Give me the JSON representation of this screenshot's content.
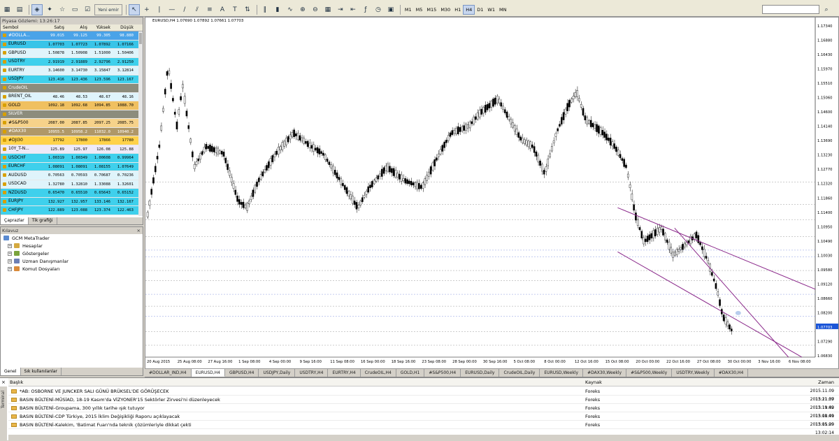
{
  "toolbar": {
    "new_order": "Yeni emir",
    "timeframes": [
      "M1",
      "M5",
      "M15",
      "M30",
      "H1",
      "H4",
      "D1",
      "W1",
      "MN"
    ],
    "active_timeframe": "H4"
  },
  "market_watch": {
    "title": "Piyasa Gözlemi: 13:26:17",
    "headers": [
      "Sembol",
      "Satış",
      "Alış",
      "Yüksek",
      "Düşük"
    ],
    "rows": [
      {
        "sym": "#DOLLA...",
        "bid": "99.015",
        "ask": "99.125",
        "high": "99.305",
        "low": "98.880",
        "bg": "#4aa3e8"
      },
      {
        "sym": "EURUSD",
        "bid": "1.07703",
        "ask": "1.07723",
        "high": "1.07892",
        "low": "1.07166",
        "bg": "#38c4e8"
      },
      {
        "sym": "GBPUSD",
        "bid": "1.50878",
        "ask": "1.50908",
        "high": "1.51000",
        "low": "1.50406",
        "bg": "#dff4fb"
      },
      {
        "sym": "USDTRY",
        "bid": "2.91919",
        "ask": "2.91889",
        "high": "2.92796",
        "low": "2.91250",
        "bg": "#3fd0ec"
      },
      {
        "sym": "EURTRY",
        "bid": "3.14600",
        "ask": "3.14730",
        "high": "3.15847",
        "low": "3.12814",
        "bg": "#dff4fb"
      },
      {
        "sym": "USDJPY",
        "bid": "123.416",
        "ask": "123.436",
        "high": "123.596",
        "low": "123.167",
        "bg": "#3fd0ec"
      },
      {
        "sym": "CrudeOIL",
        "bid": "",
        "ask": "",
        "high": "",
        "low": "",
        "bg": "#8c8c7c"
      },
      {
        "sym": "BRENT_OIL",
        "bid": "48.46",
        "ask": "48.53",
        "high": "48.67",
        "low": "48.16",
        "bg": "#dff4fb"
      },
      {
        "sym": "GOLD",
        "bid": "1092.18",
        "ask": "1092.68",
        "high": "1094.85",
        "low": "1088.70",
        "bg": "#f0c060"
      },
      {
        "sym": "SILVER",
        "bid": "",
        "ask": "",
        "high": "",
        "low": "",
        "bg": "#8c8c7c"
      },
      {
        "sym": "#S&P500",
        "bid": "2087.00",
        "ask": "2087.85",
        "high": "2097.25",
        "low": "2085.75",
        "bg": "#f6d28a"
      },
      {
        "sym": "#DAX30",
        "bid": "10955.5",
        "ask": "10958.2",
        "high": "11032.0",
        "low": "10940.2",
        "bg": "#b09868"
      },
      {
        "sym": "#DJI30",
        "bid": "17792",
        "ask": "17800",
        "high": "17866",
        "low": "17780",
        "bg": "#ffd24a"
      },
      {
        "sym": "10Y_T-N...",
        "bid": "125.89",
        "ask": "125.97",
        "high": "126.08",
        "low": "125.88",
        "bg": "#eeeaf8"
      },
      {
        "sym": "USDCHF",
        "bid": "1.00319",
        "ask": "1.00349",
        "high": "1.00608",
        "low": "0.99964",
        "bg": "#3fd0ec"
      },
      {
        "sym": "EURCHF",
        "bid": "1.08091",
        "ask": "1.08091",
        "high": "1.08155",
        "low": "1.07649",
        "bg": "#3fd0ec"
      },
      {
        "sym": "AUDUSD",
        "bid": "0.70563",
        "ask": "0.70593",
        "high": "0.70687",
        "low": "0.70236",
        "bg": "#dff4fb"
      },
      {
        "sym": "USDCAD",
        "bid": "1.32780",
        "ask": "1.32810",
        "high": "1.33088",
        "low": "1.32601",
        "bg": "#dff4fb"
      },
      {
        "sym": "NZDUSD",
        "bid": "0.65470",
        "ask": "0.65510",
        "high": "0.65643",
        "low": "0.65152",
        "bg": "#3fd0ec"
      },
      {
        "sym": "EURJPY",
        "bid": "132.927",
        "ask": "132.957",
        "high": "133.146",
        "low": "132.167",
        "bg": "#3fd0ec"
      },
      {
        "sym": "CHFJPY",
        "bid": "122.889",
        "ask": "123.088",
        "high": "123.374",
        "low": "122.463",
        "bg": "#3fd0ec"
      }
    ],
    "tabs": [
      "Çaprazlar",
      "Tik grafiği"
    ]
  },
  "navigator": {
    "title": "Kılavuz",
    "root": "GCM MetaTrader",
    "items": [
      "Hesaplar",
      "Göstergeler",
      "Uzman Danışmanlar",
      "Komut Dosyaları"
    ],
    "tabs": [
      "Genel",
      "Sık kullanılanlar"
    ]
  },
  "chart": {
    "info": "EURUSD,H4  1.07690 1.07892 1.07661 1.07703",
    "price_labels": [
      "1.17340",
      "1.16880",
      "1.16430",
      "1.15970",
      "1.15510",
      "1.15060",
      "1.14600",
      "1.14140",
      "1.13690",
      "1.13230",
      "1.12770",
      "1.12320",
      "1.11860",
      "1.11400",
      "1.10950",
      "1.10490",
      "1.10030",
      "1.09580",
      "1.09120",
      "1.08660",
      "1.08200",
      "1.07703",
      "1.07290",
      "1.06830"
    ],
    "date_labels": [
      "20 Aug 2015",
      "25 Aug 08:00",
      "27 Aug 16:00",
      "1 Sep 08:00",
      "4 Sep 00:00",
      "9 Sep 16:00",
      "11 Sep 08:00",
      "16 Sep 00:00",
      "18 Sep 16:00",
      "23 Sep 08:00",
      "28 Sep 00:00",
      "30 Sep 16:00",
      "5 Oct 08:00",
      "8 Oct 00:00",
      "12 Oct 16:00",
      "15 Oct 08:00",
      "20 Oct 00:00",
      "22 Oct 16:00",
      "27 Oct 08:00",
      "30 Oct 00:00",
      "3 Nov 16:00",
      "6 Nov 08:00"
    ],
    "current_price": "1.07703",
    "colors": {
      "channel": "#8b2a8b",
      "hline_gray": "#9a9a9a",
      "hline_blue": "#8a9ae0",
      "price_tag": "#1a55d8"
    }
  },
  "chart_tabs": [
    "#DOLLAR_IND,H4",
    "EURUSD,H4",
    "GBPUSD,H4",
    "USDJPY,Daily",
    "USDTRY,H4",
    "EURTRY,H4",
    "CrudeOIL,H4",
    "GOLD,H1",
    "#S&P500,H4",
    "EURUSD,Daily",
    "CrudeOIL,Daily",
    "EURUSD,Weekly",
    "#DAX30,Weekly",
    "#S&P500,Weekly",
    "USDTRY,Weekly",
    "#DAX30,H4"
  ],
  "active_chart_tab": 1,
  "terminal": {
    "side_label": "Terminal",
    "headers": {
      "title": "Başlık",
      "source": "Kaynak",
      "time": "Zaman"
    },
    "rows": [
      {
        "title": "*AB: OSBORNE VE JUNCKER SALI GÜNÜ BRÜKSEL'DE GÖRÜŞECEK",
        "source": "Foreks",
        "time": "2015.11.09 13:21:37"
      },
      {
        "title": "BASIN BÜLTENİ-MÜSİAD, 18-19 Kasım'da VİZYONER'15 Sektörler Zirvesi'ni düzenleyecek",
        "source": "Foreks",
        "time": "2015.11.09 13:19:42"
      },
      {
        "title": "BASIN BÜLTENİ-Groupama, 300 yıllık tarihe ışık tutuyor",
        "source": "Foreks",
        "time": "2015.11.09 13:08:41"
      },
      {
        "title": "BASIN BÜLTENİ-CDP Türkiye, 2015 İklim Değişikliği Raporu açıklayacak",
        "source": "Foreks",
        "time": "2015.11.09 13:05:29"
      },
      {
        "title": "BASIN BÜLTENİ-Kalekim, 'Batimat Fuarı'nda teknik çözümleriyle dikkat çekti",
        "source": "Foreks",
        "time": "2015.11.09 13:02:14"
      }
    ]
  }
}
